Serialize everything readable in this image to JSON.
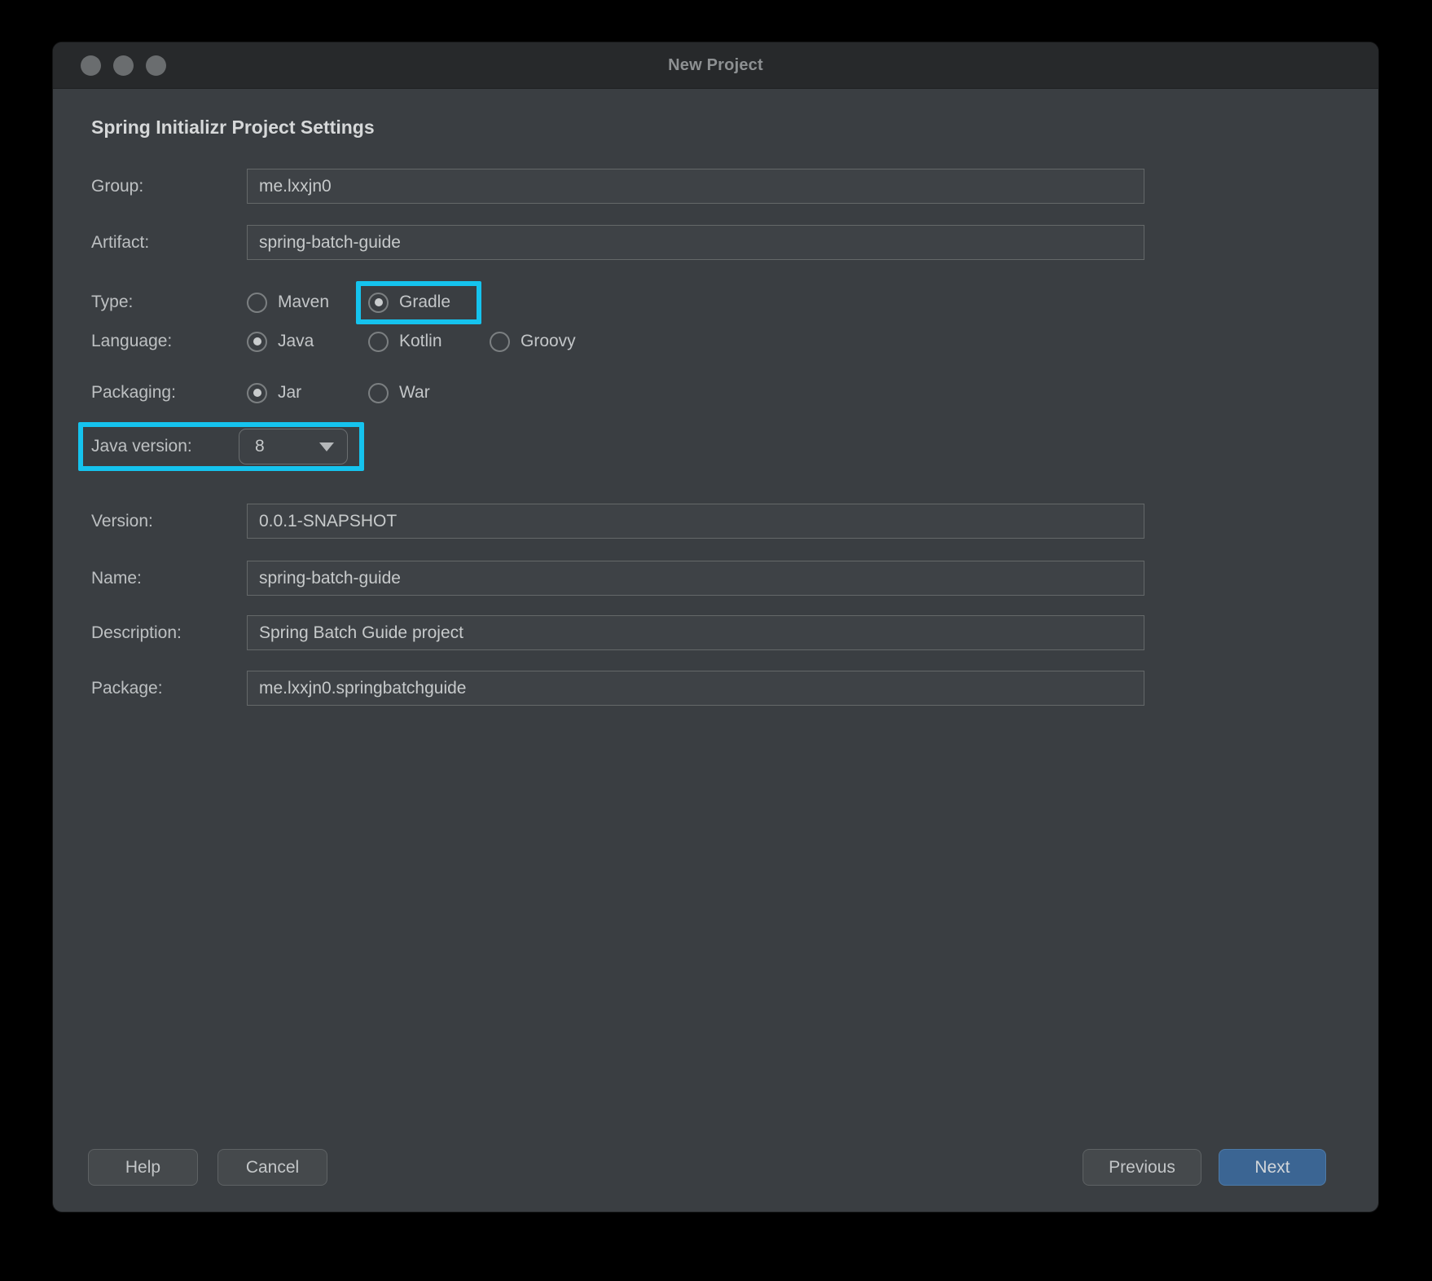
{
  "window": {
    "title": "New Project"
  },
  "heading": "Spring Initializr Project Settings",
  "form": {
    "group": {
      "label": "Group:",
      "value": "me.lxxjn0"
    },
    "artifact": {
      "label": "Artifact:",
      "value": "spring-batch-guide"
    },
    "type": {
      "label": "Type:",
      "options": [
        {
          "label": "Maven",
          "selected": false,
          "highlighted": false
        },
        {
          "label": "Gradle",
          "selected": true,
          "highlighted": true
        }
      ]
    },
    "language": {
      "label": "Language:",
      "options": [
        {
          "label": "Java",
          "selected": true,
          "highlighted": false
        },
        {
          "label": "Kotlin",
          "selected": false,
          "highlighted": false
        },
        {
          "label": "Groovy",
          "selected": false,
          "highlighted": false
        }
      ]
    },
    "packaging": {
      "label": "Packaging:",
      "options": [
        {
          "label": "Jar",
          "selected": true,
          "highlighted": false
        },
        {
          "label": "War",
          "selected": false,
          "highlighted": false
        }
      ]
    },
    "java_version": {
      "label": "Java version:",
      "value": "8",
      "highlighted": true
    },
    "version": {
      "label": "Version:",
      "value": "0.0.1-SNAPSHOT"
    },
    "name": {
      "label": "Name:",
      "value": "spring-batch-guide"
    },
    "description": {
      "label": "Description:",
      "value": "Spring Batch Guide project"
    },
    "package": {
      "label": "Package:",
      "value": "me.lxxjn0.springbatchguide"
    }
  },
  "buttons": {
    "help": "Help",
    "cancel": "Cancel",
    "previous": "Previous",
    "next": "Next"
  },
  "colors": {
    "highlight_cyan": "#15c3ee",
    "primary_button_blue": "#3b6593",
    "window_background": "#3a3e42",
    "titlebar_background": "#27292b"
  }
}
